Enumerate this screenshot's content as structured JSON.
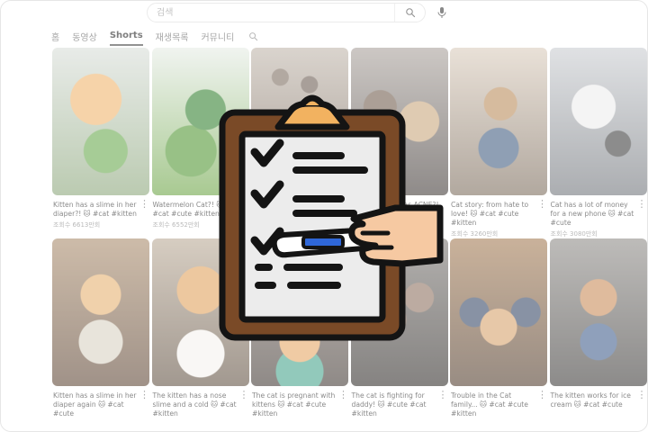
{
  "search": {
    "placeholder": "검색"
  },
  "tabs": [
    {
      "label": "홈",
      "active": false
    },
    {
      "label": "동영상",
      "active": false
    },
    {
      "label": "Shorts",
      "active": true
    },
    {
      "label": "재생목록",
      "active": false
    },
    {
      "label": "커뮤니티",
      "active": false
    }
  ],
  "videos": [
    {
      "title": "Kitten has a slime in her diaper?! 🐱 #cat #kitten",
      "views": "조회수 6613만회"
    },
    {
      "title": "Watermelon Cat?! 🐱 #cat #cute #kitten",
      "views": "조회수 6552만회"
    },
    {
      "title": "",
      "views": ""
    },
    {
      "title": "has ACNE?!",
      "views": ""
    },
    {
      "title": "Cat story: from hate to love! 🐱 #cat #cute #kitten",
      "views": "조회수 3260만회"
    },
    {
      "title": "Cat has a lot of money for a new phone 🐱 #cat #cute",
      "views": "조회수 3080만회"
    },
    {
      "title": "Kitten has a slime in her diaper again 🐱 #cat #cute",
      "views": ""
    },
    {
      "title": "The kitten has a nose slime and a cold 🐱 #cat #kitten",
      "views": ""
    },
    {
      "title": "The cat is pregnant with kittens 🐱 #cat #cute #kitten",
      "views": ""
    },
    {
      "title": "The cat is fighting for daddy! 🐱 #cute #cat #kitten",
      "views": ""
    },
    {
      "title": "Trouble in the Cat family... 🐱 #cat #cute #kitten",
      "views": ""
    },
    {
      "title": "The kitten works for ice cream 🐱 #cat #cute",
      "views": ""
    }
  ],
  "icons": {
    "search": "search-icon",
    "mic": "mic-icon",
    "more": "more-vert-icon",
    "overlay": "checklist-clipboard-icon"
  },
  "colors": {
    "clipboard_board": "#7a4a27",
    "clipboard_clip": "#f2b260",
    "paper": "#ececec",
    "pen": "#2f67d8",
    "skin": "#f6c9a2",
    "outline": "#141414"
  }
}
